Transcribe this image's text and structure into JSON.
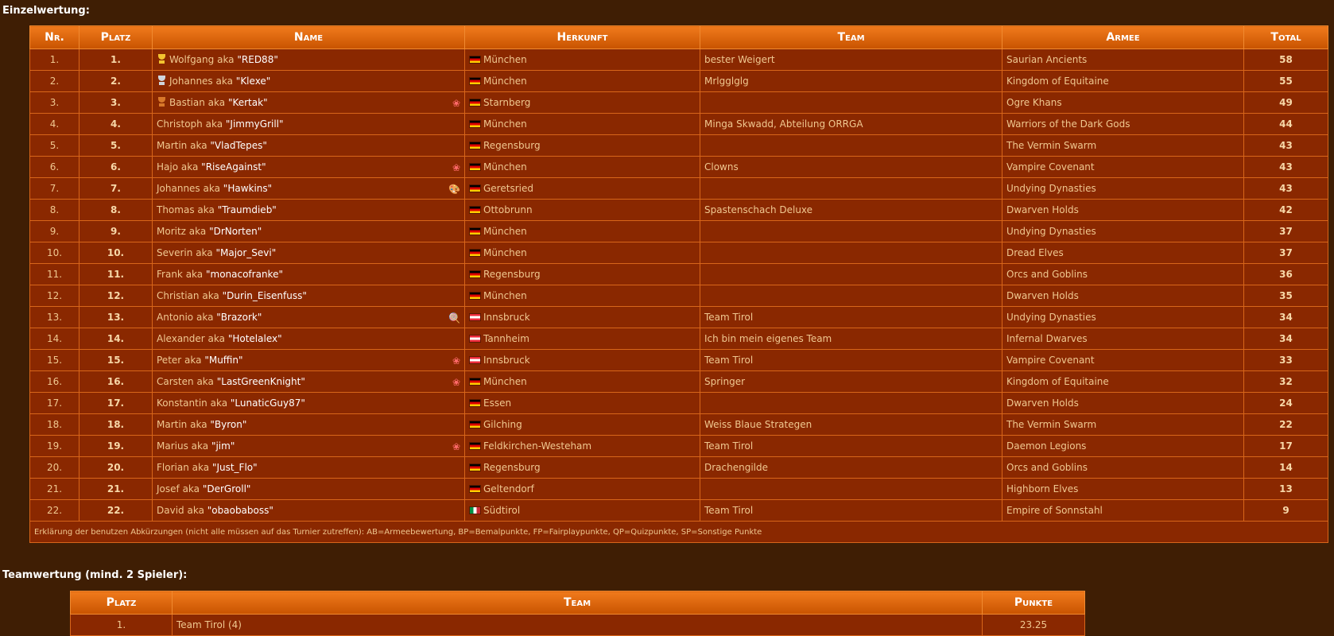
{
  "single": {
    "title": "Einzelwertung:",
    "headers": [
      "Nr.",
      "Platz",
      "Name",
      "Herkunft",
      "Team",
      "Armee",
      "Total"
    ],
    "rows": [
      {
        "nr": "1.",
        "platz": "1.",
        "first": "Wolfgang",
        "nick": "\"RED88\"",
        "trophy": "gold",
        "icon": "",
        "flag": "de",
        "city": "München",
        "team": "bester Weigert",
        "army": "Saurian Ancients",
        "total": "58"
      },
      {
        "nr": "2.",
        "platz": "2.",
        "first": "Johannes",
        "nick": "\"Klexe\"",
        "trophy": "silver",
        "icon": "",
        "flag": "de",
        "city": "München",
        "team": "Mrlgglglg",
        "army": "Kingdom of Equitaine",
        "total": "55"
      },
      {
        "nr": "3.",
        "platz": "3.",
        "first": "Bastian",
        "nick": "\"Kertak\"",
        "trophy": "bronze",
        "icon": "award",
        "flag": "de",
        "city": "Starnberg",
        "team": "",
        "army": "Ogre Khans",
        "total": "49"
      },
      {
        "nr": "4.",
        "platz": "4.",
        "first": "Christoph",
        "nick": "\"JimmyGrill\"",
        "trophy": "",
        "icon": "",
        "flag": "de",
        "city": "München",
        "team": "Minga Skwadd, Abteilung ORRGA",
        "army": "Warriors of the Dark Gods",
        "total": "44"
      },
      {
        "nr": "5.",
        "platz": "5.",
        "first": "Martin",
        "nick": "\"VladTepes\"",
        "trophy": "",
        "icon": "",
        "flag": "de",
        "city": "Regensburg",
        "team": "",
        "army": "The Vermin Swarm",
        "total": "43"
      },
      {
        "nr": "6.",
        "platz": "6.",
        "first": "Hajo",
        "nick": "\"RiseAgainst\"",
        "trophy": "",
        "icon": "award",
        "flag": "de",
        "city": "München",
        "team": "Clowns",
        "army": "Vampire Covenant",
        "total": "43"
      },
      {
        "nr": "7.",
        "platz": "7.",
        "first": "Johannes",
        "nick": "\"Hawkins\"",
        "trophy": "",
        "icon": "palette",
        "flag": "de",
        "city": "Geretsried",
        "team": "",
        "army": "Undying Dynasties",
        "total": "43"
      },
      {
        "nr": "8.",
        "platz": "8.",
        "first": "Thomas",
        "nick": "\"Traumdieb\"",
        "trophy": "",
        "icon": "",
        "flag": "de",
        "city": "Ottobrunn",
        "team": "Spastenschach Deluxe",
        "army": "Dwarven Holds",
        "total": "42"
      },
      {
        "nr": "9.",
        "platz": "9.",
        "first": "Moritz",
        "nick": "\"DrNorten\"",
        "trophy": "",
        "icon": "",
        "flag": "de",
        "city": "München",
        "team": "",
        "army": "Undying Dynasties",
        "total": "37"
      },
      {
        "nr": "10.",
        "platz": "10.",
        "first": "Severin",
        "nick": "\"Major_Sevi\"",
        "trophy": "",
        "icon": "",
        "flag": "de",
        "city": "München",
        "team": "",
        "army": "Dread Elves",
        "total": "37"
      },
      {
        "nr": "11.",
        "platz": "11.",
        "first": "Frank",
        "nick": "\"monacofranke\"",
        "trophy": "",
        "icon": "",
        "flag": "de",
        "city": "Regensburg",
        "team": "",
        "army": "Orcs and Goblins",
        "total": "36"
      },
      {
        "nr": "12.",
        "platz": "12.",
        "first": "Christian",
        "nick": "\"Durin_Eisenfuss\"",
        "trophy": "",
        "icon": "",
        "flag": "de",
        "city": "München",
        "team": "",
        "army": "Dwarven Holds",
        "total": "35"
      },
      {
        "nr": "13.",
        "platz": "13.",
        "first": "Antonio",
        "nick": "\"Brazork\"",
        "trophy": "",
        "icon": "lollipop",
        "flag": "at",
        "city": "Innsbruck",
        "team": "Team Tirol",
        "army": "Undying Dynasties",
        "total": "34"
      },
      {
        "nr": "14.",
        "platz": "14.",
        "first": "Alexander",
        "nick": "\"Hotelalex\"",
        "trophy": "",
        "icon": "",
        "flag": "at",
        "city": "Tannheim",
        "team": "Ich bin mein eigenes Team",
        "army": "Infernal Dwarves",
        "total": "34"
      },
      {
        "nr": "15.",
        "platz": "15.",
        "first": "Peter",
        "nick": "\"Muffin\"",
        "trophy": "",
        "icon": "award",
        "flag": "at",
        "city": "Innsbruck",
        "team": "Team Tirol",
        "army": "Vampire Covenant",
        "total": "33"
      },
      {
        "nr": "16.",
        "platz": "16.",
        "first": "Carsten",
        "nick": "\"LastGreenKnight\"",
        "trophy": "",
        "icon": "award",
        "flag": "de",
        "city": "München",
        "team": "Springer",
        "army": "Kingdom of Equitaine",
        "total": "32"
      },
      {
        "nr": "17.",
        "platz": "17.",
        "first": "Konstantin",
        "nick": "\"LunaticGuy87\"",
        "trophy": "",
        "icon": "",
        "flag": "de",
        "city": "Essen",
        "team": "",
        "army": "Dwarven Holds",
        "total": "24"
      },
      {
        "nr": "18.",
        "platz": "18.",
        "first": "Martin",
        "nick": "\"Byron\"",
        "trophy": "",
        "icon": "",
        "flag": "de",
        "city": "Gilching",
        "team": "Weiss Blaue Strategen",
        "army": "The Vermin Swarm",
        "total": "22"
      },
      {
        "nr": "19.",
        "platz": "19.",
        "first": "Marius",
        "nick": "\"jim\"",
        "trophy": "",
        "icon": "award",
        "flag": "de",
        "city": "Feldkirchen-Westeham",
        "team": "Team Tirol",
        "army": "Daemon Legions",
        "total": "17"
      },
      {
        "nr": "20.",
        "platz": "20.",
        "first": "Florian",
        "nick": "\"Just_Flo\"",
        "trophy": "",
        "icon": "",
        "flag": "de",
        "city": "Regensburg",
        "team": "Drachengilde",
        "army": "Orcs and Goblins",
        "total": "14"
      },
      {
        "nr": "21.",
        "platz": "21.",
        "first": "Josef",
        "nick": "\"DerGroll\"",
        "trophy": "",
        "icon": "",
        "flag": "de",
        "city": "Geltendorf",
        "team": "",
        "army": "Highborn Elves",
        "total": "13"
      },
      {
        "nr": "22.",
        "platz": "22.",
        "first": "David",
        "nick": "\"obaobaboss\"",
        "trophy": "",
        "icon": "",
        "flag": "it",
        "city": "Südtirol",
        "team": "Team Tirol",
        "army": "Empire of Sonnstahl",
        "total": "9"
      }
    ],
    "aka": "aka",
    "footnote": "Erklärung der benutzen Abkürzungen (nicht alle müssen auf das Turnier zutreffen): AB=Armeebewertung, BP=Bemalpunkte, FP=Fairplaypunkte, QP=Quizpunkte, SP=Sonstige Punkte"
  },
  "team": {
    "title": "Teamwertung (mind. 2 Spieler):",
    "headers": [
      "Platz",
      "Team",
      "Punkte"
    ],
    "rows": [
      {
        "platz": "1.",
        "team": "Team Tirol (4)",
        "punkte": "23.25"
      }
    ]
  },
  "colors": {
    "page_bg": "#3f1e04",
    "header_top": "#f07a1c",
    "header_bottom": "#c85300",
    "row_bg": "#8a2800",
    "border": "#d8661a",
    "flag_de": "#dd0000",
    "flag_at": "#ed2939",
    "flag_it": "#009246"
  },
  "icons": {
    "award": "award-ribbon-icon",
    "palette": "paint-palette-icon",
    "lollipop": "lollipop-icon",
    "gold": "gold-trophy-icon",
    "silver": "silver-trophy-icon",
    "bronze": "bronze-trophy-icon"
  }
}
